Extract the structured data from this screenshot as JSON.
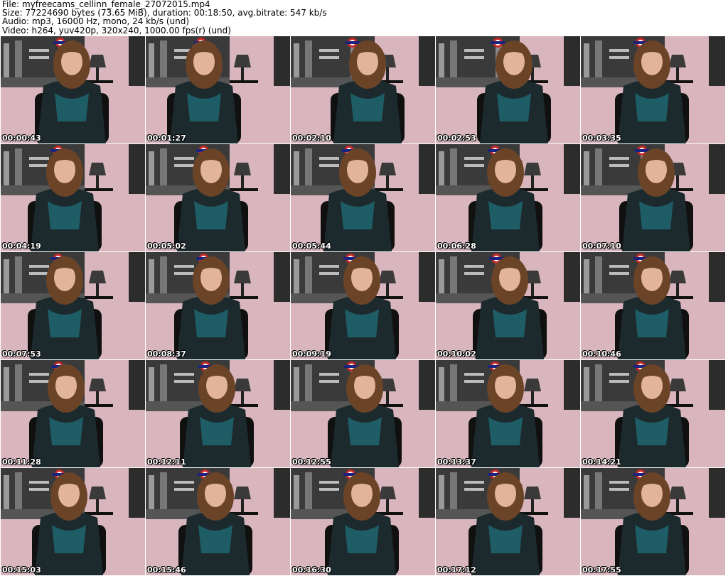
{
  "header": {
    "file": "File: myfreecams_cellinn_female_27072015.mp4",
    "size": "Size: 77224690 bytes (73.65 MiB), duration: 00:18:50, avg.bitrate: 547 kb/s",
    "audio": "Audio: mp3, 16000 Hz, mono, 24 kb/s (und)",
    "video": "Video: h264, yuv420p, 320x240, 1000.00 fps(r) (und)"
  },
  "thumbnails": [
    {
      "time": "00:00:43"
    },
    {
      "time": "00:01:27"
    },
    {
      "time": "00:02:10"
    },
    {
      "time": "00:02:53"
    },
    {
      "time": "00:03:35"
    },
    {
      "time": "00:04:19"
    },
    {
      "time": "00:05:02"
    },
    {
      "time": "00:05:44"
    },
    {
      "time": "00:06:28"
    },
    {
      "time": "00:07:10"
    },
    {
      "time": "00:07:53"
    },
    {
      "time": "00:08:37"
    },
    {
      "time": "00:09:19"
    },
    {
      "time": "00:10:02"
    },
    {
      "time": "00:10:46"
    },
    {
      "time": "00:11:28"
    },
    {
      "time": "00:12:11"
    },
    {
      "time": "00:12:55"
    },
    {
      "time": "00:13:37"
    },
    {
      "time": "00:14:21"
    },
    {
      "time": "00:15:03"
    },
    {
      "time": "00:15:46"
    },
    {
      "time": "00:16:30"
    },
    {
      "time": "00:17:12"
    },
    {
      "time": "00:17:55"
    }
  ],
  "colors": {
    "wall": "#d9b6bd",
    "poster": "#3a3a3a",
    "hair": "#6b4428",
    "top": "#1c2a2e",
    "teal": "#1f6f78"
  }
}
